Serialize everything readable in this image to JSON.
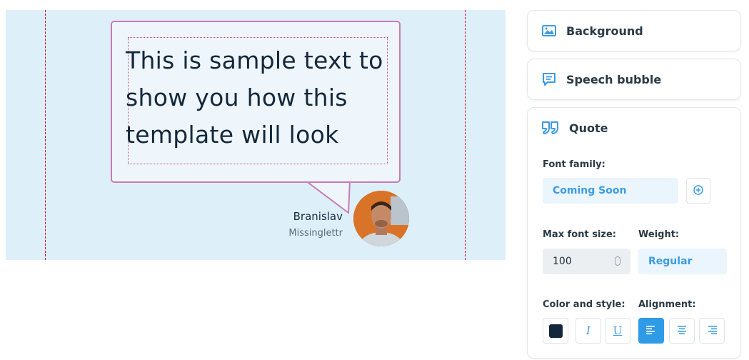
{
  "preview": {
    "quote_lines": [
      "This is sample text to",
      "show you how this",
      "template will look"
    ],
    "author_name": "Branislav",
    "author_handle": "Missinglettr"
  },
  "panel": {
    "background": {
      "title": "Background",
      "icon": "image-icon"
    },
    "speech_bubble": {
      "title": "Speech bubble",
      "icon": "speech-bubble-icon"
    },
    "quote": {
      "title": "Quote",
      "icon": "quote-marks-icon",
      "font_family_label": "Font family:",
      "font_family_value": "Coming Soon",
      "max_font_size_label": "Max font size:",
      "max_font_size_value": "100",
      "weight_label": "Weight:",
      "weight_value": "Regular",
      "color_style_label": "Color and style:",
      "alignment_label": "Alignment:",
      "text_color": "#14283d",
      "italic_glyph": "I",
      "underline_glyph": "U",
      "alignment_options": [
        "left",
        "center",
        "right"
      ],
      "alignment_selected": "left"
    }
  },
  "colors": {
    "accent": "#2f9ae6",
    "canvas_bg": "#ddf0fa",
    "bubble_border": "#c97bb5",
    "guide_line": "#d0021b"
  }
}
